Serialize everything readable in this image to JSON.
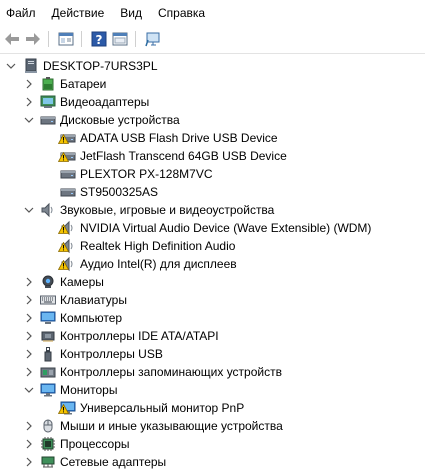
{
  "menu": [
    "Файл",
    "Действие",
    "Вид",
    "Справка"
  ],
  "toolbar": {
    "buttons": [
      "back-arrow-icon",
      "forward-arrow-icon",
      "properties-icon",
      "help-icon",
      "view-icon",
      "monitor-scan-icon"
    ]
  },
  "tree": {
    "root": "DESKTOP-7URS3PL",
    "categories": [
      {
        "label": "Батареи",
        "icon": "battery-icon",
        "expanded": false,
        "devices": []
      },
      {
        "label": "Видеоадаптеры",
        "icon": "display-adapter-icon",
        "expanded": false,
        "devices": []
      },
      {
        "label": "Дисковые устройства",
        "icon": "disk-drive-icon",
        "expanded": true,
        "devices": [
          {
            "label": "ADATA USB Flash Drive USB Device",
            "warning": true
          },
          {
            "label": "JetFlash Transcend 64GB USB Device",
            "warning": true
          },
          {
            "label": "PLEXTOR PX-128M7VC",
            "warning": false
          },
          {
            "label": "ST9500325AS",
            "warning": false
          }
        ]
      },
      {
        "label": "Звуковые, игровые и видеоустройства",
        "icon": "speaker-icon",
        "expanded": true,
        "devices": [
          {
            "label": "NVIDIA Virtual Audio Device (Wave Extensible) (WDM)",
            "warning": true
          },
          {
            "label": "Realtek High Definition Audio",
            "warning": true
          },
          {
            "label": "Аудио Intel(R) для дисплеев",
            "warning": true
          }
        ]
      },
      {
        "label": "Камеры",
        "icon": "camera-icon",
        "expanded": false,
        "devices": []
      },
      {
        "label": "Клавиатуры",
        "icon": "keyboard-icon",
        "expanded": false,
        "devices": []
      },
      {
        "label": "Компьютер",
        "icon": "computer-icon",
        "expanded": false,
        "devices": []
      },
      {
        "label": "Контроллеры IDE ATA/ATAPI",
        "icon": "ide-controller-icon",
        "expanded": false,
        "devices": []
      },
      {
        "label": "Контроллеры USB",
        "icon": "usb-icon",
        "expanded": false,
        "devices": []
      },
      {
        "label": "Контроллеры запоминающих устройств",
        "icon": "storage-controller-icon",
        "expanded": false,
        "devices": []
      },
      {
        "label": "Мониторы",
        "icon": "monitor-icon",
        "expanded": true,
        "devices": [
          {
            "label": "Универсальный монитор PnP",
            "warning": true
          }
        ]
      },
      {
        "label": "Мыши и иные указывающие устройства",
        "icon": "mouse-icon",
        "expanded": false,
        "devices": []
      },
      {
        "label": "Процессоры",
        "icon": "processor-icon",
        "expanded": false,
        "devices": []
      },
      {
        "label": "Сетевые адаптеры",
        "icon": "network-adapter-icon",
        "expanded": false,
        "devices": []
      }
    ]
  },
  "colors": {
    "warning": "#f5c400",
    "chevron": "#555555"
  }
}
